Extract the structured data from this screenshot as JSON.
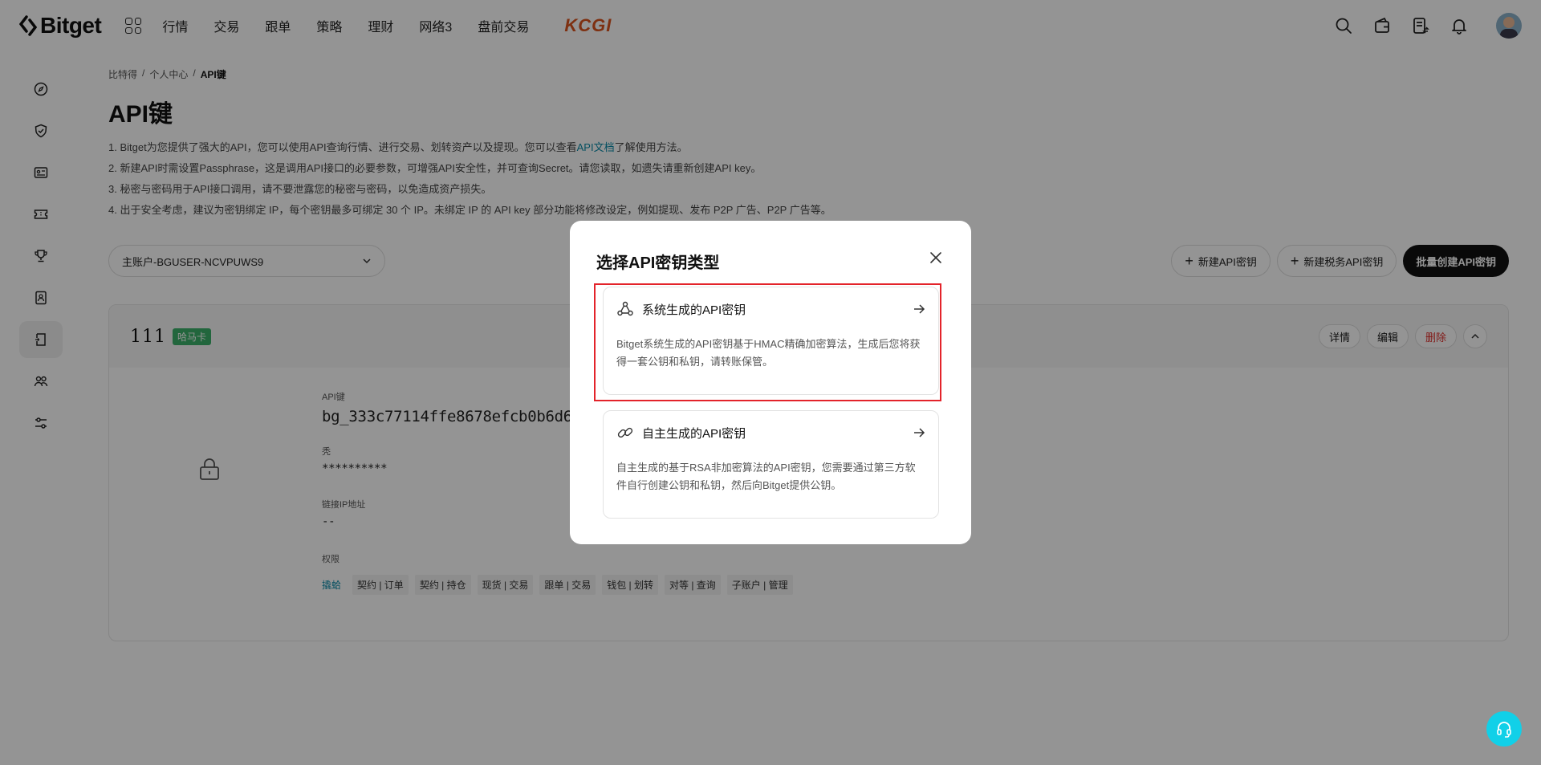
{
  "header": {
    "logo_text": "Bitget",
    "nav": [
      "行情",
      "交易",
      "跟单",
      "策略",
      "理财",
      "网络3",
      "盘前交易"
    ],
    "brand_badge": "KCGI"
  },
  "breadcrumb": [
    "比特得",
    "个人中心",
    "API键"
  ],
  "page_title": "API键",
  "notes": {
    "line1_pre": "1. Bitget为您提供了强大的API，您可以使用API查询行情、进行交易、划转资产以及提现。您可以查看",
    "line1_link": "API文档",
    "line1_post": "了解使用方法。",
    "line2": "2. 新建API时需设置Passphrase，这是调用API接口的必要参数，可增强API安全性，并可查询Secret。请您读取，如遗失请重新创建API key。",
    "line3": "3. 秘密与密码用于API接口调用，请不要泄露您的秘密与密码，以免造成资产损失。",
    "line4": "4. 出于安全考虑，建议为密钥绑定 IP，每个密钥最多可绑定 30 个 IP。未绑定 IP 的 API key 部分功能将修改设定，例如提现、发布 P2P 广告、P2P 广告等。"
  },
  "toolbar": {
    "account": "主账户-BGUSER-NCVPUWS9",
    "new_key": "新建API密钥",
    "new_tax_key": "新建税务API密钥",
    "batch_create": "批量创建API密钥"
  },
  "key_card": {
    "name": "111",
    "tag": "哈马卡",
    "actions": {
      "details": "详情",
      "edit": "编辑",
      "delete": "删除"
    },
    "api_key_label": "API键",
    "api_key_value": "bg_333c77114ffe8678efcb0b6d68",
    "secret_label": "秃",
    "secret_value": "**********",
    "ip_label": "链接IP地址",
    "ip_value": "--",
    "perms_label": "权限",
    "perms": [
      "撬蛤",
      "契约 | 订单",
      "契约 | 持仓",
      "现货 | 交易",
      "跟单 | 交易",
      "钱包 | 划转",
      "对等 | 查询",
      "子账户 | 管理"
    ]
  },
  "modal": {
    "title": "选择API密钥类型",
    "option1_title": "系统生成的API密钥",
    "option1_desc": "Bitget系统生成的API密钥基于HMAC精确加密算法，生成后您将获得一套公钥和私钥，请转账保管。",
    "option2_title": "自主生成的API密钥",
    "option2_desc": "自主生成的基于RSA非加密算法的API密钥，您需要通过第三方软件自行创建公钥和私钥，然后向Bitget提供公钥。"
  },
  "colors": {
    "accent_link": "#0b8aa8",
    "highlight": "#e3232a",
    "tag_green": "#3bb06a",
    "support": "#11d0e8",
    "brand_badge": "#d9531e"
  }
}
